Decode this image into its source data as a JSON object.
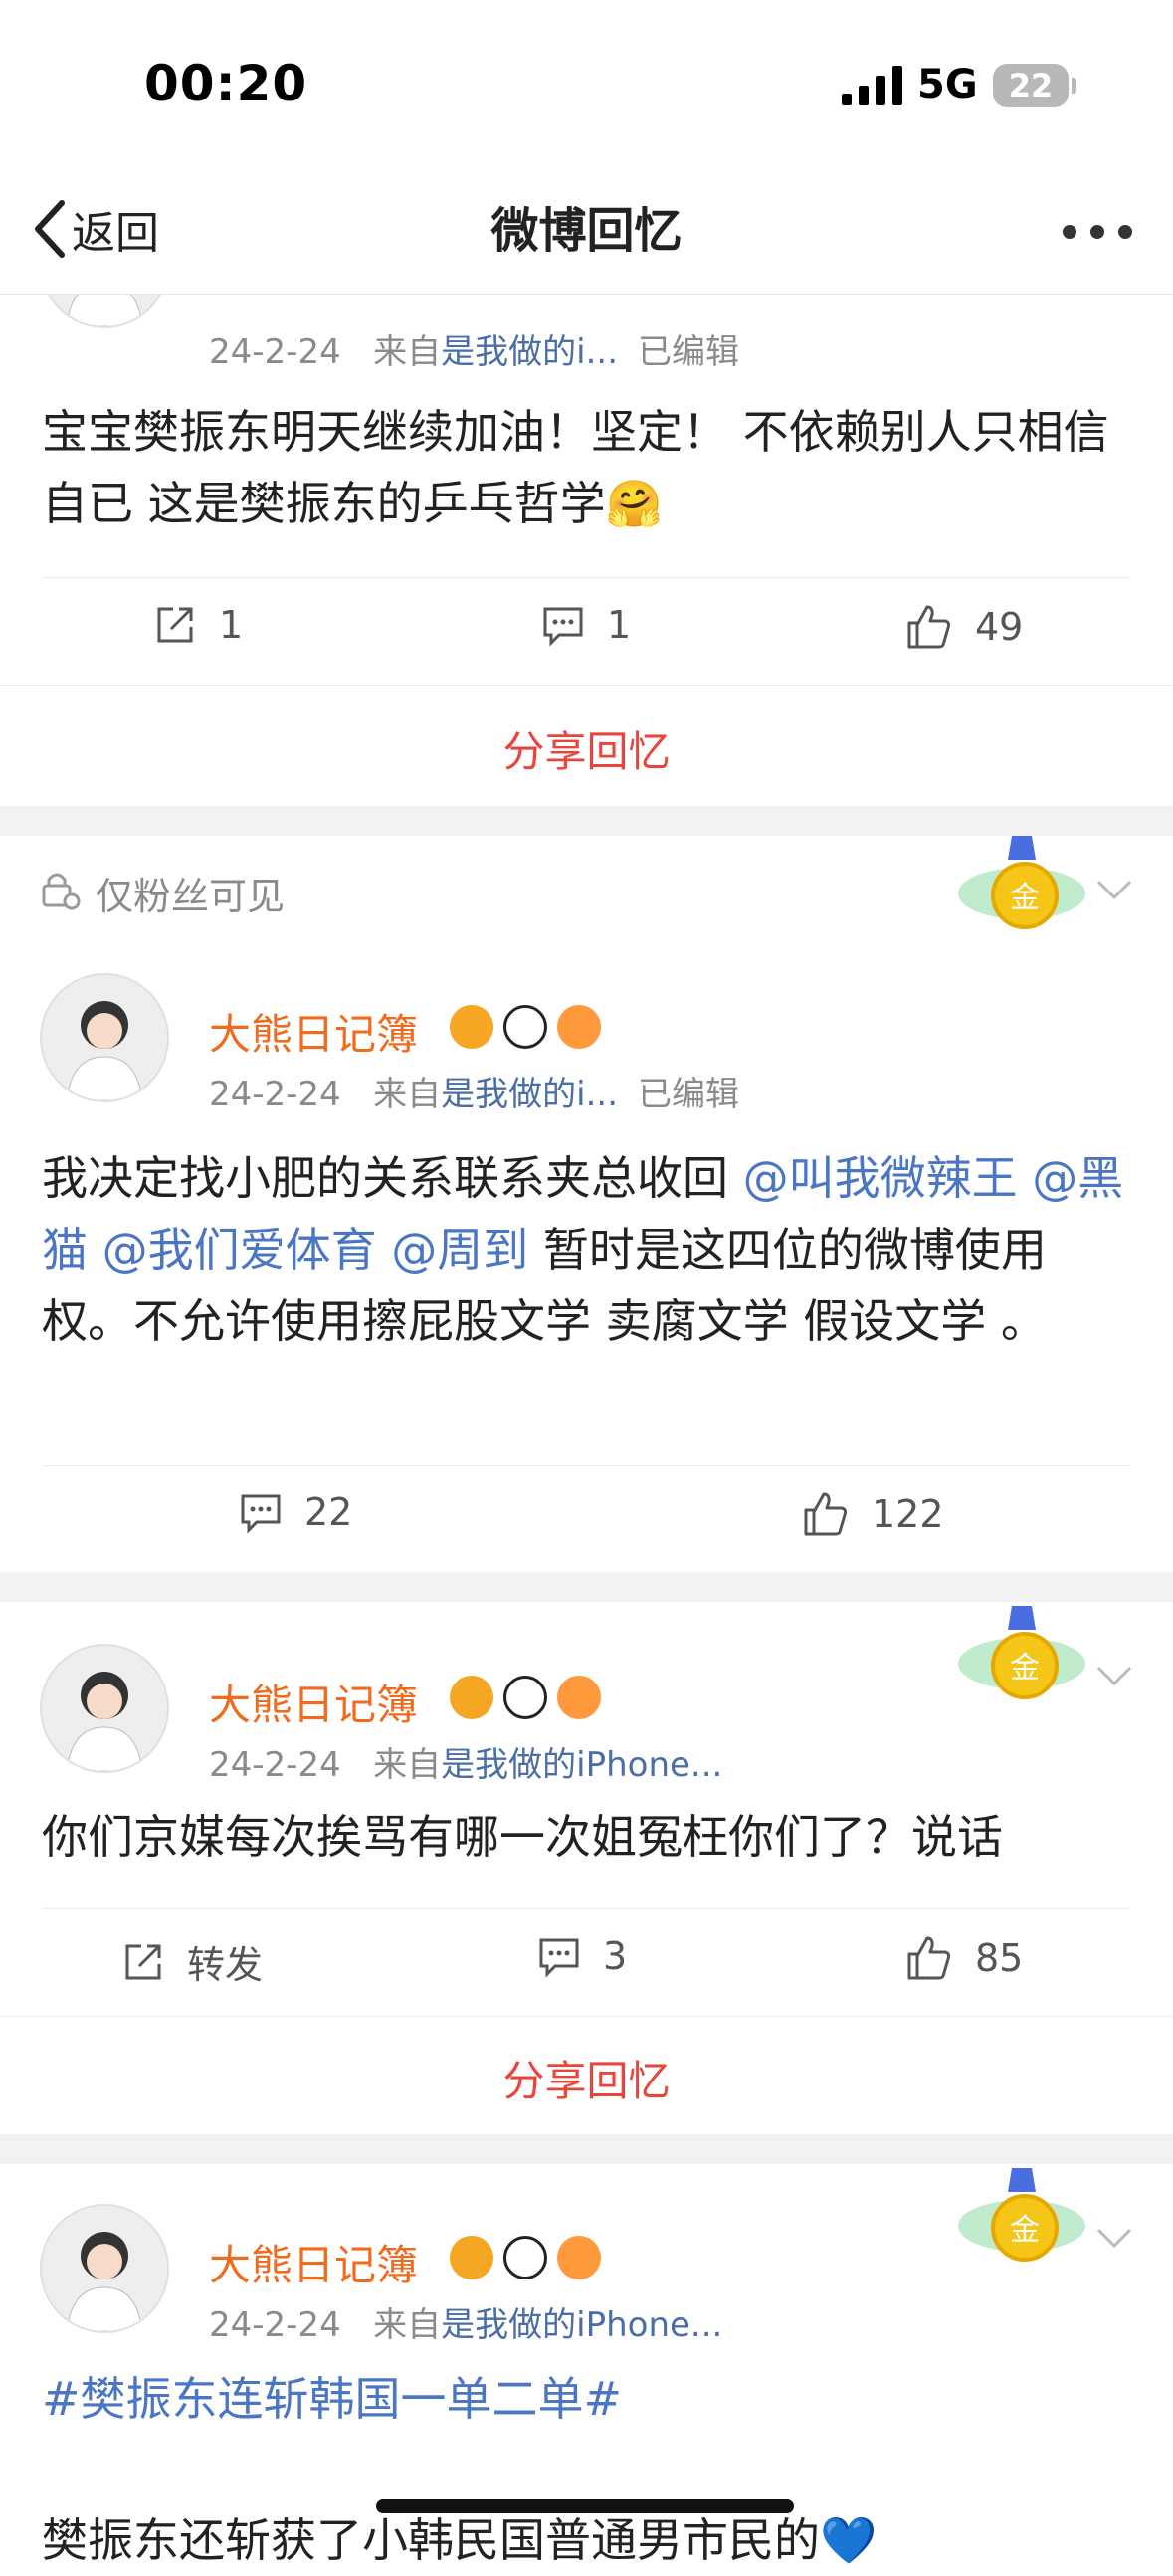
{
  "status": {
    "time": "00:20",
    "network": "5G",
    "battery": "22"
  },
  "nav": {
    "back_label": "返回",
    "title": "微博回忆"
  },
  "posts": [
    {
      "username": "大熊日记簿",
      "date": "24-2-24",
      "from_prefix": "来自",
      "source": "是我做的i...",
      "edited": "已编辑",
      "text": "宝宝樊振东明天继续加油！坚定！ 不依赖别人只相信自已 这是樊振东的乒乓哲学🤗",
      "repost_count": "1",
      "comment_count": "1",
      "like_count": "49",
      "share_label": "分享回忆"
    },
    {
      "visibility": "仅粉丝可见",
      "username": "大熊日记簿",
      "date": "24-2-24",
      "from_prefix": "来自",
      "source": "是我做的i...",
      "edited": "已编辑",
      "text_before": "我决定找小肥的关系联系夹总收回",
      "mentions": [
        "@叫我微辣王",
        "@黑猫",
        "@我们爱体育",
        "@周到"
      ],
      "text_after": "暂时是这四位的微博使用权。不允许使用擦屁股文学 卖腐文学 假设文学 。",
      "comment_count": "22",
      "like_count": "122"
    },
    {
      "username": "大熊日记簿",
      "date": "24-2-24",
      "from_prefix": "来自",
      "source": "是我做的iPhone...",
      "text": "你们京媒每次挨骂有哪一次姐冤枉你们了？说话",
      "repost_label": "转发",
      "comment_count": "3",
      "like_count": "85",
      "share_label": "分享回忆"
    },
    {
      "username": "大熊日记簿",
      "date": "24-2-24",
      "from_prefix": "来自",
      "source": "是我做的iPhone...",
      "topic": "#樊振东连斩韩国一单二单#",
      "text": "樊振东还斩获了小韩民国普通男市民的💙"
    }
  ],
  "colors": {
    "username": "#f06b1d",
    "link": "#4a76c4",
    "share": "#e8463c",
    "gold": "#f5c518"
  }
}
